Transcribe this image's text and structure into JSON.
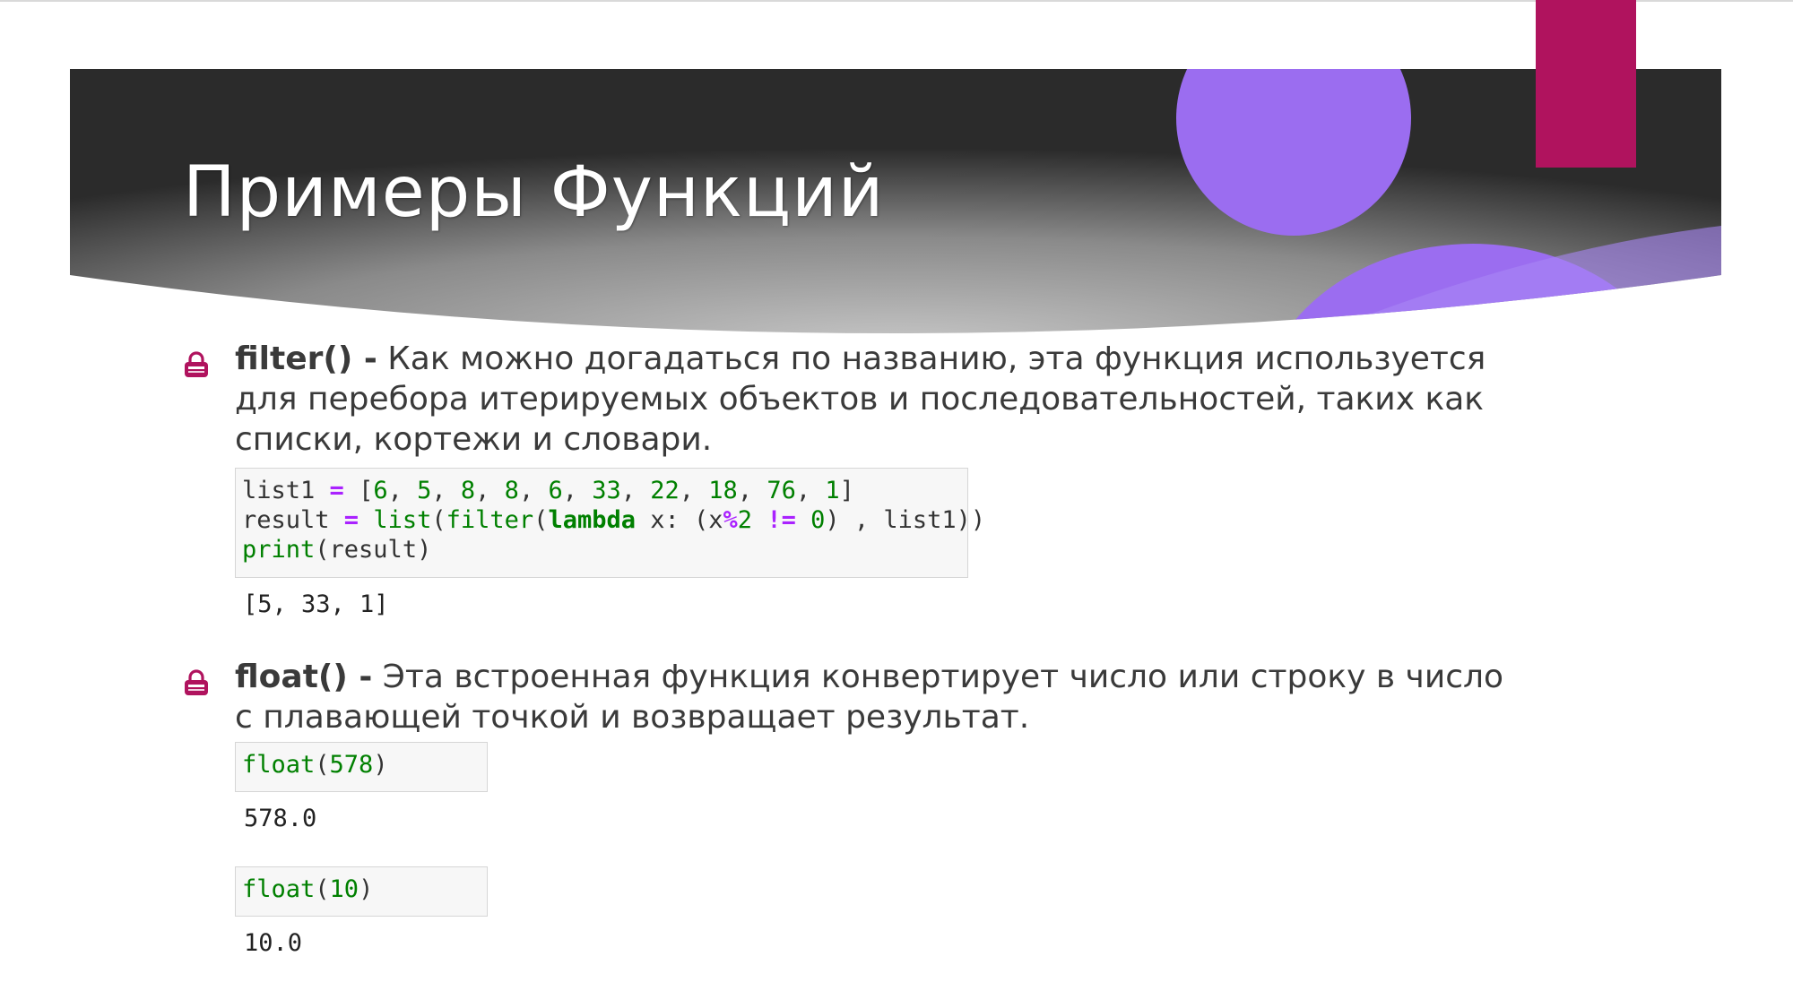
{
  "slide": {
    "title": "Примеры Функций"
  },
  "colors": {
    "banner_dark": "#2b2b2b",
    "banner_light": "#c4c4c4",
    "purple": "#9b6df0",
    "magenta": "#b0135e",
    "bullet": "#b0135e"
  },
  "bullets": [
    {
      "icon": "lock-icon",
      "keyword": "filter() -",
      "text": " Как можно догадаться по названию, эта функция используется для перебора итерируемых объектов и последовательностей, таких как списки, кортежи и словари.",
      "code": {
        "l1": {
          "a": "list1 ",
          "b": "=",
          "c": " [",
          "d": "6",
          "e": ", ",
          "f": "5",
          "g": ", ",
          "h": "8",
          "i": ", ",
          "j": "8",
          "k": ", ",
          "l": "6",
          "m": ", ",
          "n": "33",
          "o": ", ",
          "p": "22",
          "q": ", ",
          "r": "18",
          "s": ", ",
          "t": "76",
          "u": ", ",
          "v": "1",
          "w": "]"
        },
        "l2": {
          "a": "result ",
          "b": "=",
          "c": " ",
          "d": "list",
          "e": "(",
          "f": "filter",
          "g": "(",
          "h": "lambda",
          "i": " x: (x",
          "j": "%",
          "k": "2",
          "l": " ",
          "m": "!=",
          "n": " ",
          "o": "0",
          "p": ") , list1))"
        },
        "l3": {
          "a": "print",
          "b": "(result)"
        }
      },
      "output": "[5, 33, 1]"
    },
    {
      "icon": "lock-icon",
      "keyword": "float() -",
      "text": " Эта встроенная функция конвертирует число или строку в число с плавающей точкой и возвращает результат.",
      "examples": [
        {
          "fn": "float",
          "open": "(",
          "arg": "578",
          "close": ")",
          "output": "578.0"
        },
        {
          "fn": "float",
          "open": "(",
          "arg": "10",
          "close": ")",
          "output": "10.0"
        }
      ]
    }
  ]
}
